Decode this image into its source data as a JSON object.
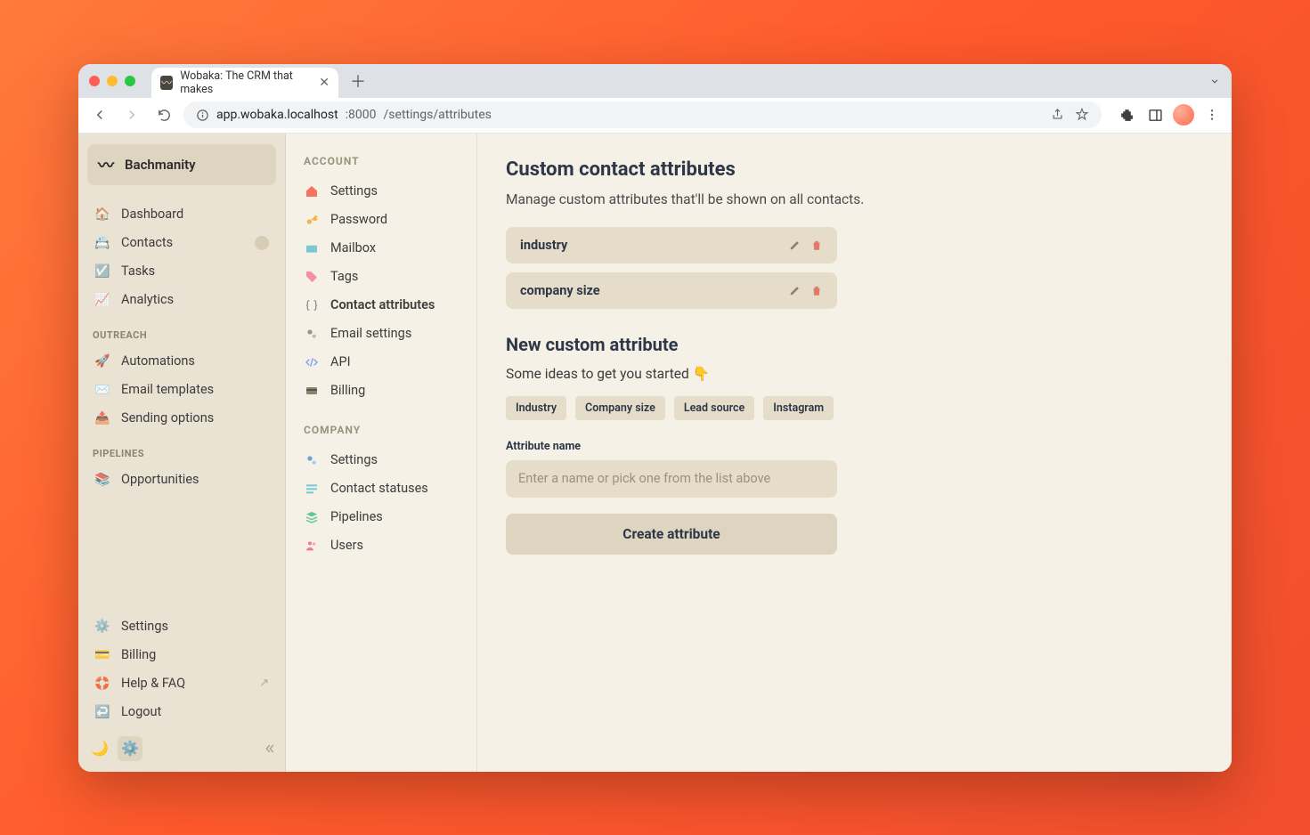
{
  "browser": {
    "tab_title": "Wobaka: The CRM that makes",
    "url_host": "app.wobaka.localhost",
    "url_port": ":8000",
    "url_path": "/settings/attributes"
  },
  "org": {
    "name": "Bachmanity"
  },
  "sidebar": {
    "items": [
      {
        "label": "Dashboard"
      },
      {
        "label": "Contacts"
      },
      {
        "label": "Tasks"
      },
      {
        "label": "Analytics"
      }
    ],
    "outreach_header": "OUTREACH",
    "outreach": [
      {
        "label": "Automations"
      },
      {
        "label": "Email templates"
      },
      {
        "label": "Sending options"
      }
    ],
    "pipelines_header": "PIPELINES",
    "pipelines": [
      {
        "label": "Opportunities"
      }
    ],
    "footer": [
      {
        "label": "Settings"
      },
      {
        "label": "Billing"
      },
      {
        "label": "Help & FAQ"
      },
      {
        "label": "Logout"
      }
    ]
  },
  "settings_nav": {
    "account_header": "ACCOUNT",
    "account": [
      {
        "label": "Settings"
      },
      {
        "label": "Password"
      },
      {
        "label": "Mailbox"
      },
      {
        "label": "Tags"
      },
      {
        "label": "Contact attributes"
      },
      {
        "label": "Email settings"
      },
      {
        "label": "API"
      },
      {
        "label": "Billing"
      }
    ],
    "company_header": "COMPANY",
    "company": [
      {
        "label": "Settings"
      },
      {
        "label": "Contact statuses"
      },
      {
        "label": "Pipelines"
      },
      {
        "label": "Users"
      }
    ]
  },
  "main": {
    "title": "Custom contact attributes",
    "subtitle": "Manage custom attributes that'll be shown on all contacts.",
    "attributes": [
      {
        "name": "industry"
      },
      {
        "name": "company size"
      }
    ],
    "new_title": "New custom attribute",
    "ideas_text": "Some ideas to get you started 👇",
    "suggestions": [
      "Industry",
      "Company size",
      "Lead source",
      "Instagram"
    ],
    "field_label": "Attribute name",
    "placeholder": "Enter a name or pick one from the list above",
    "button": "Create attribute"
  }
}
